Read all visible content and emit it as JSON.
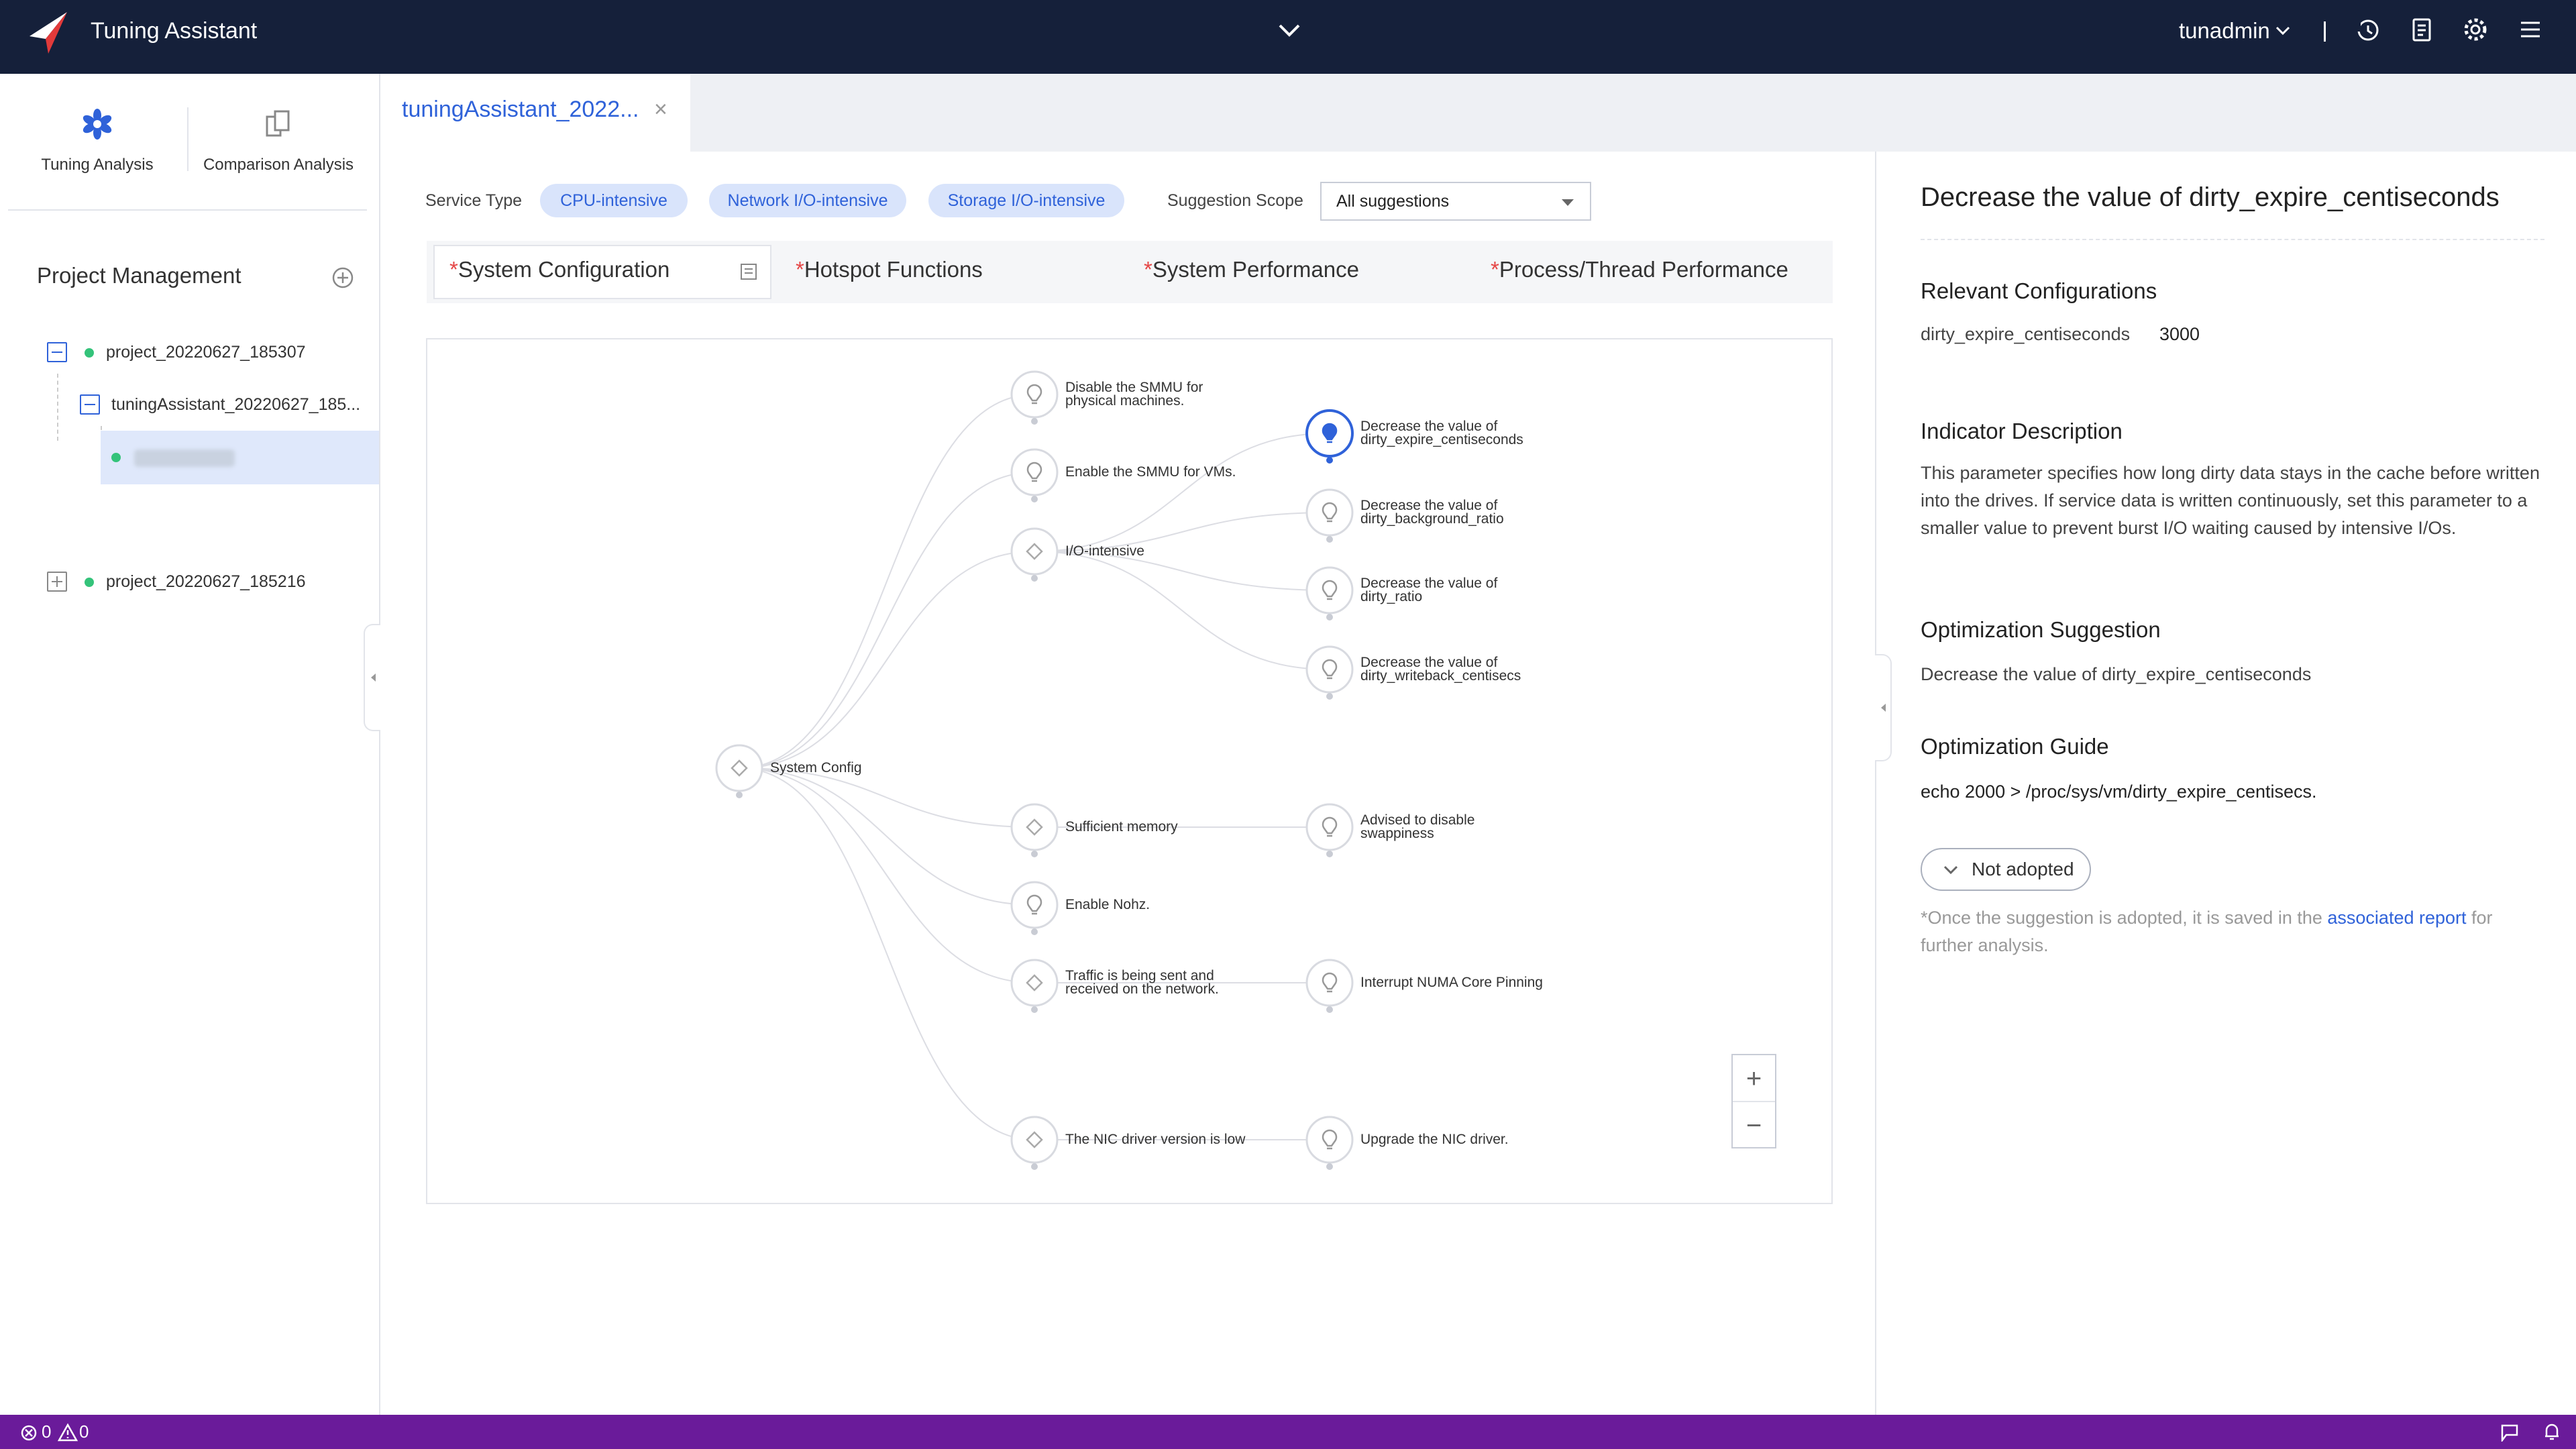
{
  "app": {
    "title": "Tuning Assistant",
    "user": "tunadmin"
  },
  "topbar": {
    "icons": [
      "logo-icon",
      "chevron-down-icon",
      "history-icon",
      "report-icon",
      "gear-icon",
      "menu-icon"
    ]
  },
  "sidebar": {
    "nav": [
      {
        "label": "Tuning Analysis",
        "icon": "tuning-icon"
      },
      {
        "label": "Comparison Analysis",
        "icon": "compare-icon"
      }
    ],
    "section_title": "Project Management",
    "tree": [
      {
        "label": "project_20220627_185307"
      },
      {
        "label": "tuningAssistant_20220627_185..."
      },
      {
        "label": ""
      },
      {
        "label": "project_20220627_185216"
      }
    ]
  },
  "main": {
    "tab_label": "tuningAssistant_2022...",
    "service_type_label": "Service Type",
    "service_types": [
      "CPU-intensive",
      "Network I/O-intensive",
      "Storage I/O-intensive"
    ],
    "scope_label": "Suggestion Scope",
    "scope_value": "All suggestions",
    "subtabs": [
      "System Configuration",
      "Hotspot Functions",
      "System Performance",
      "Process/Thread Performance"
    ],
    "graph": {
      "root": "System Config",
      "level1": [
        "Disable the SMMU for physical machines.",
        "Enable the SMMU for VMs.",
        "I/O-intensive",
        "Sufficient memory",
        "Enable Nohz.",
        "Traffic is being sent and received on the network.",
        "The NIC driver version is low"
      ],
      "level2": [
        "Decrease the value of dirty_expire_centiseconds",
        "Decrease the value of dirty_background_ratio",
        "Decrease the value of dirty_ratio",
        "Decrease the value of dirty_writeback_centisecs",
        "Advised to disable swappiness",
        "Interrupt NUMA Core Pinning",
        "Upgrade the NIC driver."
      ]
    },
    "zoom": {
      "in": "+",
      "out": "−"
    }
  },
  "detail": {
    "title": "Decrease the value of dirty_expire_centiseconds",
    "relevant_heading": "Relevant Configurations",
    "config_name": "dirty_expire_centiseconds",
    "config_value": "3000",
    "indicator_heading": "Indicator Description",
    "indicator_text": "This parameter specifies how long dirty data stays in the cache before written into the drives. If service data is written continuously, set this parameter to a smaller value to prevent burst I/O waiting caused by intensive I/Os.",
    "suggestion_heading": "Optimization Suggestion",
    "suggestion_text": "Decrease the value of dirty_expire_centiseconds",
    "guide_heading": "Optimization Guide",
    "guide_text": "echo 2000 > /proc/sys/vm/dirty_expire_centisecs.",
    "adopt_button": "Not adopted",
    "note_prefix": "*Once the suggestion is adopted, it is saved in the ",
    "note_link": "associated report",
    "note_suffix": " for further analysis."
  },
  "statusbar": {
    "errors": "0",
    "warnings": "0"
  },
  "colors": {
    "topbar": "#15203a",
    "accent": "#2f62d9",
    "pill_bg": "#d9e4fb",
    "statusbar": "#6a1b9a",
    "dot": "#34c37a"
  }
}
